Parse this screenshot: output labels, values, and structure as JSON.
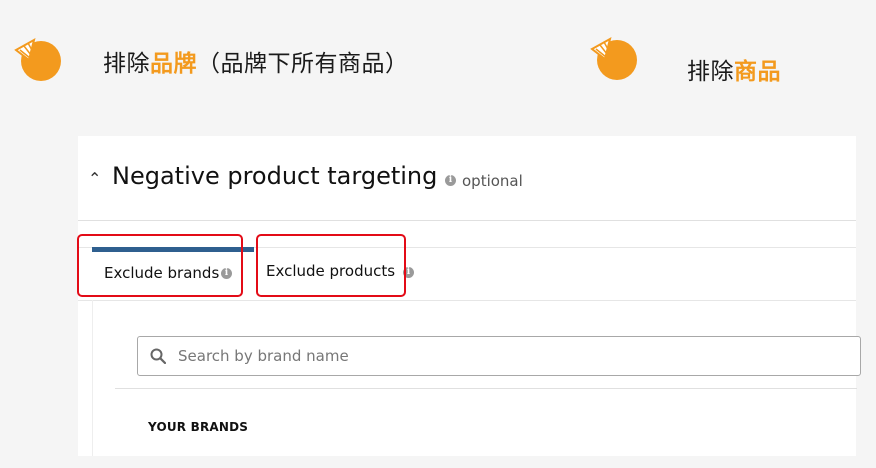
{
  "colors": {
    "accent_orange": "#f39a1e",
    "tab_active_bar": "#2f5f8f",
    "highlight_red": "#e30b17",
    "panel_bg": "#ffffff",
    "slide_bg": "#f5f5f5"
  },
  "slide": {
    "left_heading": {
      "icon": "pie-chart-icon",
      "prefix": "排除",
      "highlight": "品牌",
      "suffix": "（品牌下所有商品）"
    },
    "right_heading": {
      "icon": "pie-chart-icon",
      "prefix": "排除",
      "highlight": "商品"
    }
  },
  "section": {
    "collapse_icon": "chevron-up-icon",
    "title": "Negative product targeting",
    "info_glyph": "i",
    "optional_label": "optional"
  },
  "tabs": [
    {
      "label": "Exclude brands",
      "active": true,
      "info_glyph": "i"
    },
    {
      "label": "Exclude products",
      "active": false,
      "info_glyph": "i"
    }
  ],
  "search": {
    "icon": "search-icon",
    "placeholder": "Search by brand name",
    "value": ""
  },
  "list": {
    "heading": "YOUR BRANDS"
  }
}
